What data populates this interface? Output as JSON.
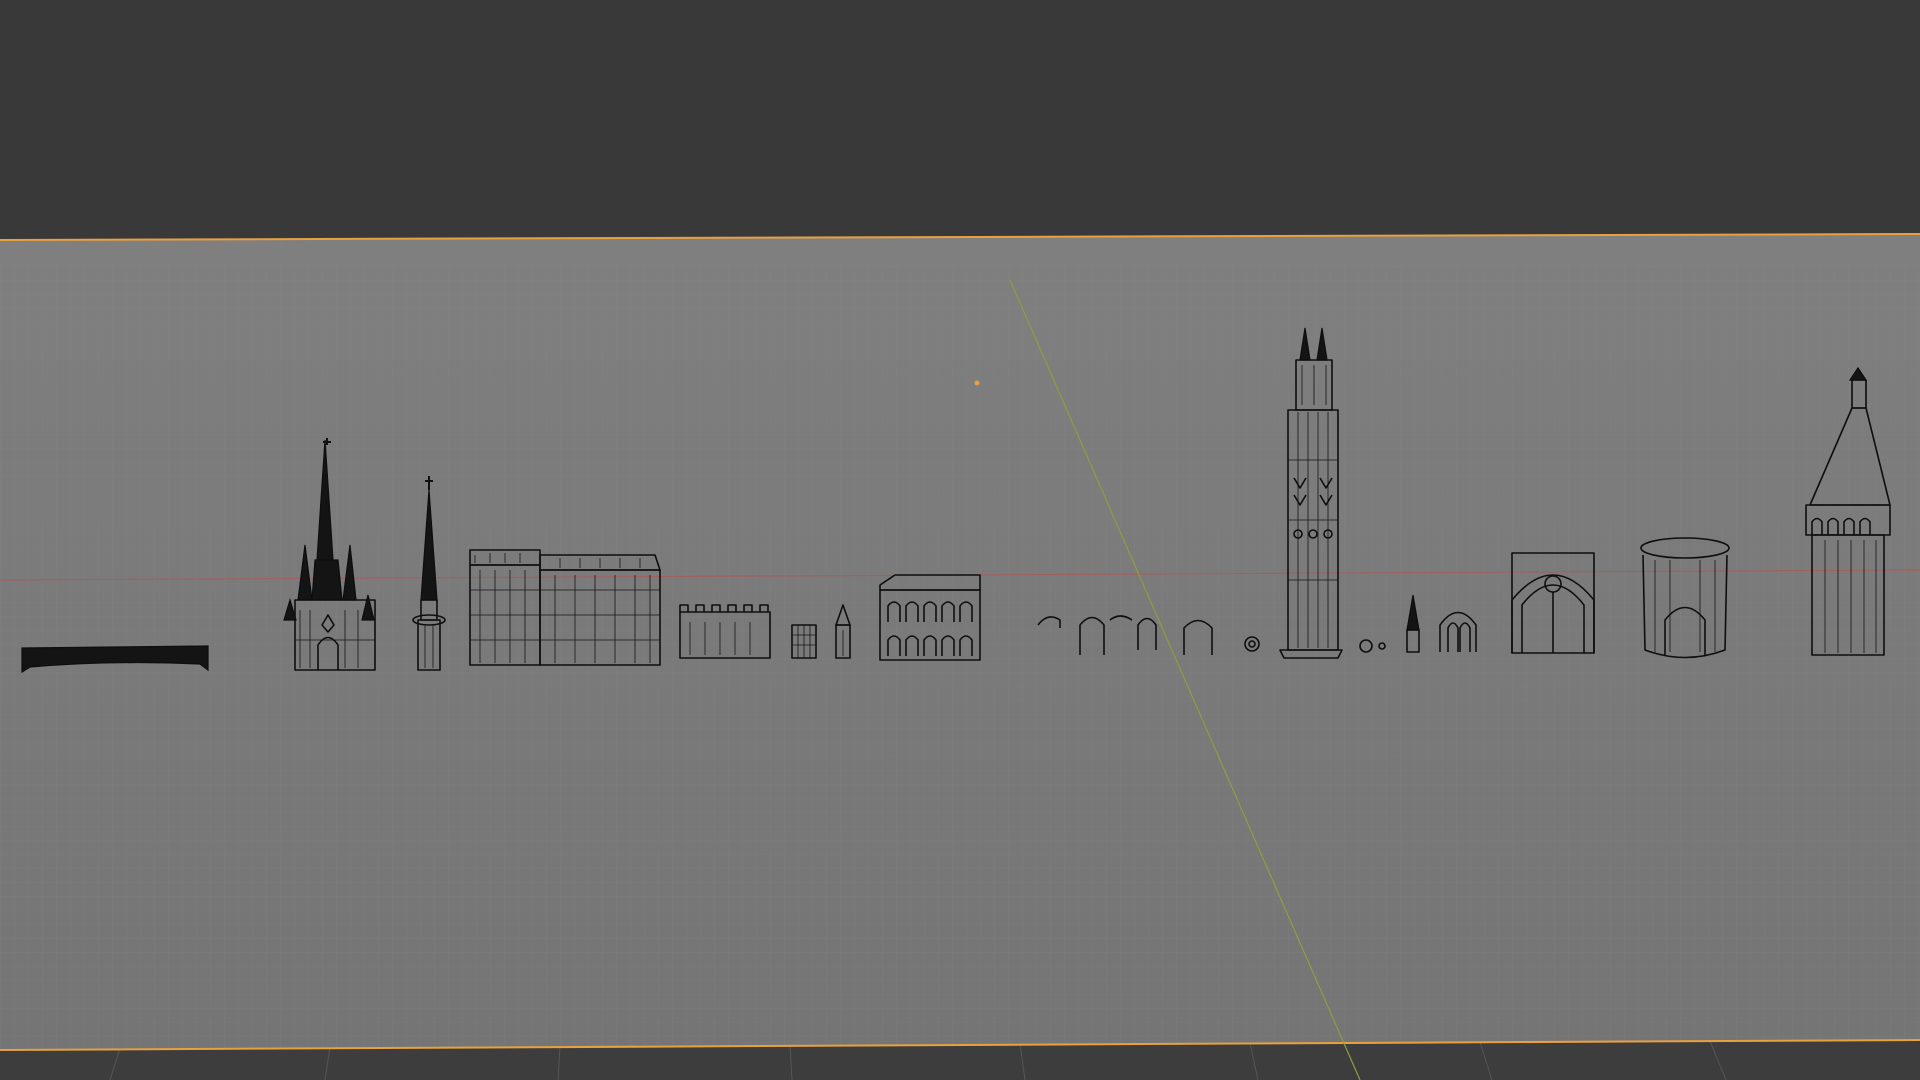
{
  "app": {
    "name": "3D viewport",
    "view": "wireframe",
    "colors": {
      "background_top": "#393939",
      "ground_plane": "#7b7b7b",
      "ground_dark": "#3d3d3d",
      "grid": "#8a8a8a",
      "x_axis": "#a05a5a",
      "y_axis": "#8aa040",
      "selection_outline": "#e8a040",
      "wireframe": "#0e0e0e"
    }
  },
  "scene": {
    "objects": [
      {
        "name": "bridge-wall",
        "icon": "wall-model"
      },
      {
        "name": "cathedral-spires",
        "icon": "cathedral-model"
      },
      {
        "name": "tall-spire",
        "icon": "spire-model"
      },
      {
        "name": "manor-house",
        "icon": "house-model"
      },
      {
        "name": "crenellated-wall",
        "icon": "wall-model"
      },
      {
        "name": "small-gate",
        "icon": "gate-model"
      },
      {
        "name": "small-tower",
        "icon": "tower-model"
      },
      {
        "name": "arcade-building",
        "icon": "building-model"
      },
      {
        "name": "arch-pieces",
        "icon": "arch-model"
      },
      {
        "name": "rose-window",
        "icon": "window-model"
      },
      {
        "name": "bell-tower",
        "icon": "tower-model"
      },
      {
        "name": "pinnacle-set",
        "icon": "pinnacle-model"
      },
      {
        "name": "double-arch",
        "icon": "arch-model"
      },
      {
        "name": "portal-arch",
        "icon": "portal-model"
      },
      {
        "name": "round-turret",
        "icon": "turret-model"
      },
      {
        "name": "corner-tower",
        "icon": "tower-model"
      }
    ]
  }
}
